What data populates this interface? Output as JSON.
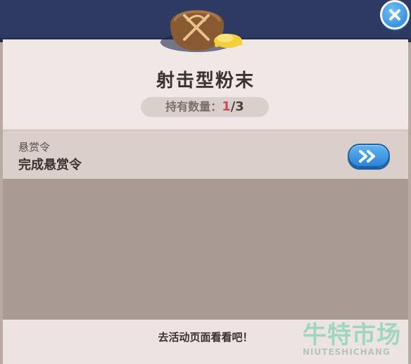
{
  "item": {
    "name": "射击型粉末",
    "icon": "bow-powder-bag-icon",
    "count_label": "持有数量：",
    "count_current": "1",
    "count_separator": "/",
    "count_total": "3"
  },
  "source": {
    "label": "悬赏令",
    "value": "完成悬赏令",
    "go_icon": "double-chevron-right-icon"
  },
  "footer": {
    "hint": "去活动页面看看吧！"
  },
  "watermark": {
    "main": "牛特市场",
    "sub": "NIUTESHICHANG"
  },
  "colors": {
    "top_band": "#2f3a63",
    "panel": "#ece3df",
    "accent_blue": "#2c82d6",
    "count_highlight": "#d04a52"
  }
}
